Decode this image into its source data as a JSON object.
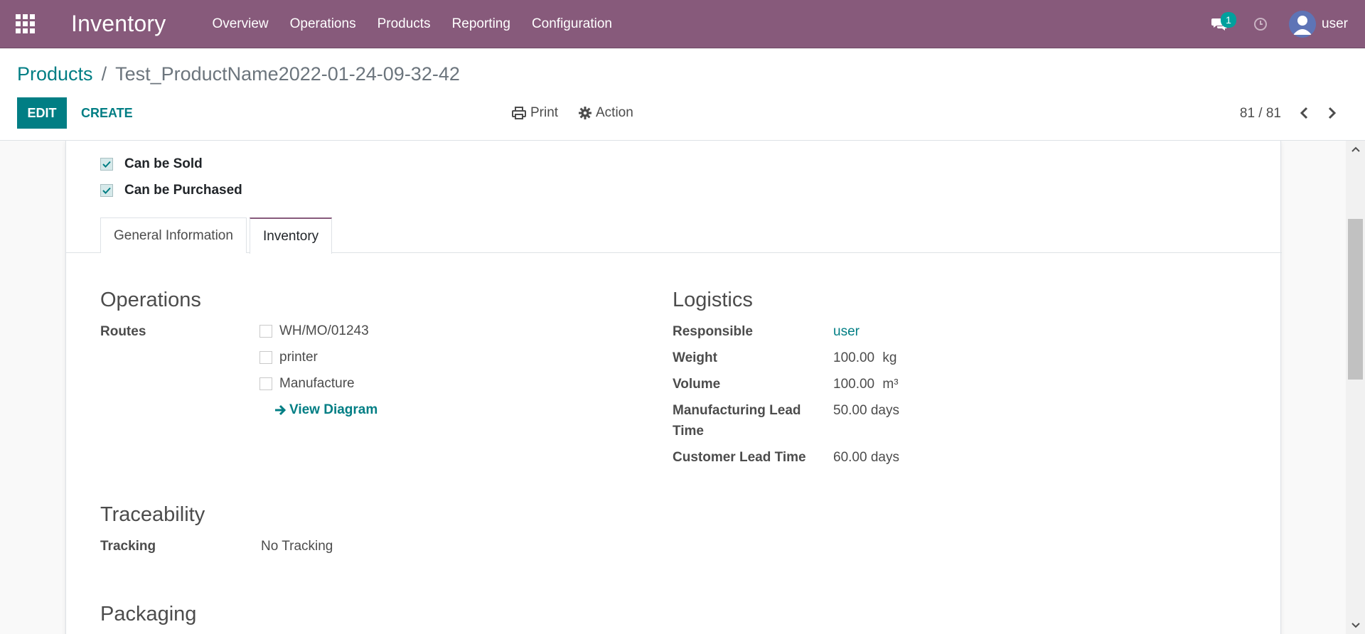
{
  "navbar": {
    "brand": "Inventory",
    "menu": [
      "Overview",
      "Operations",
      "Products",
      "Reporting",
      "Configuration"
    ],
    "chat_count": "1",
    "user": "user"
  },
  "breadcrumb": {
    "parent": "Products",
    "separator": "/",
    "current": "Test_ProductName2022-01-24-09-32-42"
  },
  "toolbar": {
    "edit": "EDIT",
    "create": "CREATE",
    "print": "Print",
    "action": "Action",
    "pager": "81 / 81"
  },
  "form": {
    "checkboxes": [
      {
        "label": "Can be Sold",
        "checked": true
      },
      {
        "label": "Can be Purchased",
        "checked": true
      }
    ],
    "tabs": [
      "General Information",
      "Inventory"
    ],
    "active_tab": "Inventory",
    "operations": {
      "title": "Operations",
      "routes_label": "Routes",
      "routes": [
        "WH/MO/01243",
        "printer",
        "Manufacture"
      ],
      "view_diagram": "View Diagram"
    },
    "logistics": {
      "title": "Logistics",
      "responsible_label": "Responsible",
      "responsible": "user",
      "weight_label": "Weight",
      "weight": "100.00",
      "weight_unit": "kg",
      "volume_label": "Volume",
      "volume": "100.00",
      "volume_unit": "m³",
      "mfg_lead_label_1": "Manufacturing Lead",
      "mfg_lead_label_2": "Time",
      "mfg_lead": "50.00 days",
      "customer_lead_label": "Customer Lead Time",
      "customer_lead": "60.00 days"
    },
    "traceability": {
      "title": "Traceability",
      "tracking_label": "Tracking",
      "tracking": "No Tracking"
    },
    "packaging": {
      "title": "Packaging"
    }
  },
  "colors": {
    "navbar": "#875a7b",
    "accent": "#017e84",
    "badge": "#00a09d"
  }
}
